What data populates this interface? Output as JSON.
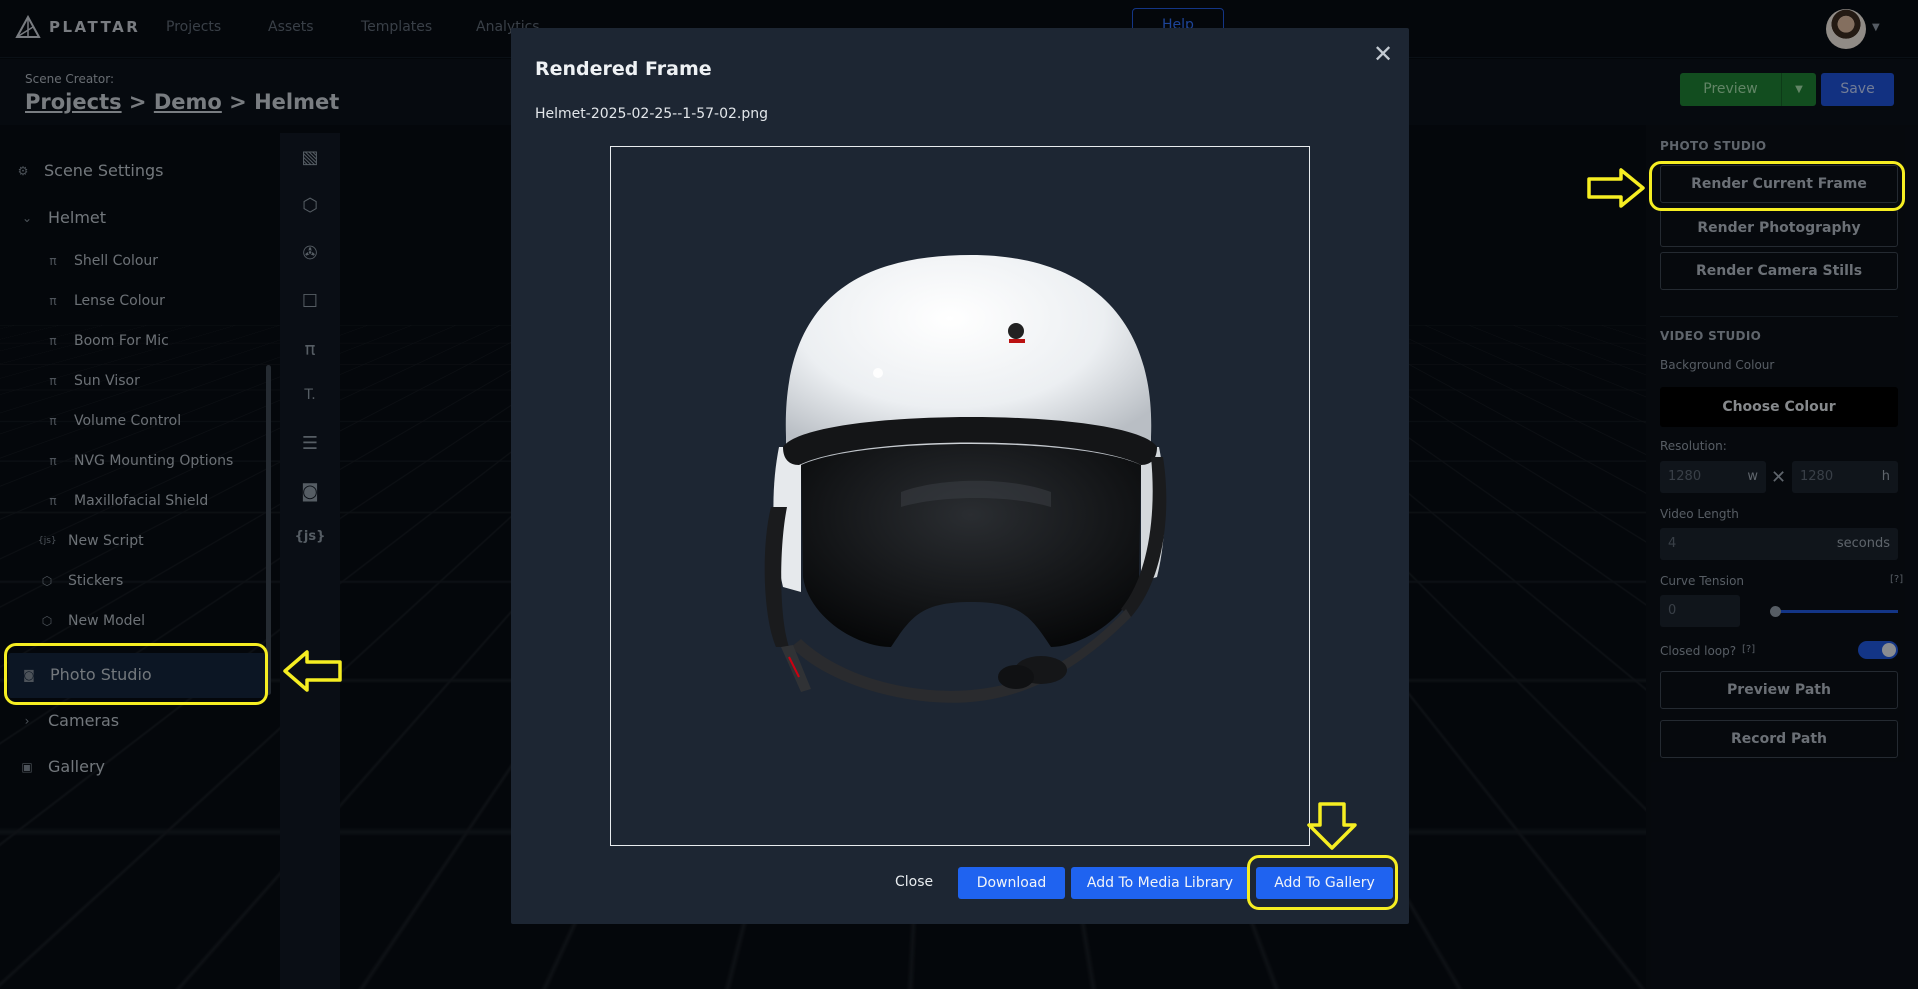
{
  "topnav": {
    "logo": "PLATTAR",
    "links": [
      "Projects",
      "Assets",
      "Templates",
      "Analytics"
    ],
    "help": "Help"
  },
  "subheader": {
    "scene_label": "Scene Creator:",
    "crumb_projects": "Projects",
    "crumb_demo": "Demo",
    "crumb_current": "Helmet",
    "sep": ">",
    "preview": "Preview",
    "save": "Save"
  },
  "sidebar": {
    "scene_settings": "Scene Settings",
    "helmet": "Helmet",
    "variations": [
      "Shell Colour",
      "Lense Colour",
      "Boom For Mic",
      "Sun Visor",
      "Volume Control",
      "NVG Mounting Options",
      "Maxillofacial Shield"
    ],
    "new_script": "New Script",
    "stickers": "Stickers",
    "new_model": "New Model",
    "photo_studio": "Photo Studio",
    "cameras": "Cameras",
    "gallery": "Gallery"
  },
  "toolstrip": {
    "js_label": "{js}",
    "text_label": "T"
  },
  "right_panel": {
    "photo_studio_title": "PHOTO STUDIO",
    "render_current": "Render Current Frame",
    "render_photography": "Render Photography",
    "render_camera_stills": "Render Camera Stills",
    "video_studio_title": "VIDEO STUDIO",
    "background_colour_label": "Background Colour",
    "choose_colour": "Choose Colour",
    "resolution_label": "Resolution:",
    "res_w_placeholder": "1280",
    "res_w_suffix": "w",
    "res_h_placeholder": "1280",
    "res_h_suffix": "h",
    "video_length_label": "Video Length",
    "video_length_placeholder": "4",
    "video_length_suffix": "seconds",
    "curve_tension_label": "Curve Tension",
    "curve_tension_help": "[?]",
    "curve_tension_placeholder": "0",
    "curve_tension_value": 0,
    "closed_loop_label": "Closed loop?",
    "closed_loop_help": "[?]",
    "closed_loop_on": true,
    "preview_path": "Preview Path",
    "record_path": "Record Path"
  },
  "modal": {
    "title": "Rendered Frame",
    "filename": "Helmet-2025-02-25--1-57-02.png",
    "close_text": "Close",
    "download": "Download",
    "add_media_library": "Add To Media Library",
    "add_gallery": "Add To Gallery"
  },
  "colors": {
    "accent_blue": "#1f63f0",
    "preview_green": "#1d7c33",
    "highlight_yellow": "#f6ee22"
  },
  "icons": {
    "close": "close-icon",
    "gear": "gear-icon",
    "camera": "camera-icon",
    "cube": "cube-icon",
    "variation": "variation-icon"
  }
}
